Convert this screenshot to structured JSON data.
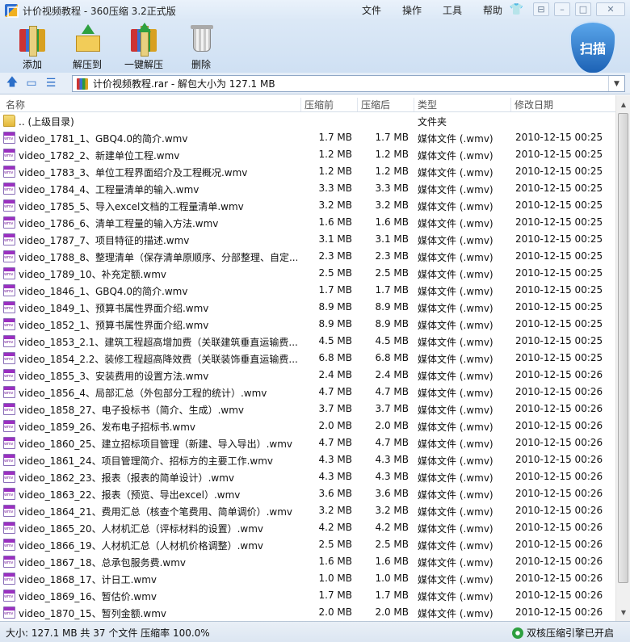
{
  "window": {
    "title": "计价视频教程 - 360压缩 3.2正式版"
  },
  "menu": [
    "文件",
    "操作",
    "工具",
    "帮助"
  ],
  "toolbar": {
    "add": "添加",
    "extract_to": "解压到",
    "one_click": "一键解压",
    "delete": "删除",
    "scan": "扫描"
  },
  "address": {
    "text": "计价视频教程.rar - 解包大小为 127.1 MB"
  },
  "columns": {
    "name": "名称",
    "packed": "压缩前",
    "unpacked": "压缩后",
    "type": "类型",
    "modified": "修改日期"
  },
  "parent_row": {
    "name": ".. (上级目录)",
    "type": "文件夹"
  },
  "files": [
    {
      "name": "video_1781_1、GBQ4.0的简介.wmv",
      "size1": "1.7 MB",
      "size2": "1.7 MB",
      "type": "媒体文件 (.wmv)",
      "date": "2010-12-15 00:25"
    },
    {
      "name": "video_1782_2、新建单位工程.wmv",
      "size1": "1.2 MB",
      "size2": "1.2 MB",
      "type": "媒体文件 (.wmv)",
      "date": "2010-12-15 00:25"
    },
    {
      "name": "video_1783_3、单位工程界面绍介及工程概况.wmv",
      "size1": "1.2 MB",
      "size2": "1.2 MB",
      "type": "媒体文件 (.wmv)",
      "date": "2010-12-15 00:25"
    },
    {
      "name": "video_1784_4、工程量清单的输入.wmv",
      "size1": "3.3 MB",
      "size2": "3.3 MB",
      "type": "媒体文件 (.wmv)",
      "date": "2010-12-15 00:25"
    },
    {
      "name": "video_1785_5、导入excel文档的工程量清单.wmv",
      "size1": "3.2 MB",
      "size2": "3.2 MB",
      "type": "媒体文件 (.wmv)",
      "date": "2010-12-15 00:25"
    },
    {
      "name": "video_1786_6、清单工程量的输入方法.wmv",
      "size1": "1.6 MB",
      "size2": "1.6 MB",
      "type": "媒体文件 (.wmv)",
      "date": "2010-12-15 00:25"
    },
    {
      "name": "video_1787_7、项目特征的描述.wmv",
      "size1": "3.1 MB",
      "size2": "3.1 MB",
      "type": "媒体文件 (.wmv)",
      "date": "2010-12-15 00:25"
    },
    {
      "name": "video_1788_8、整理清单（保存清单原顺序、分部整理、自定...",
      "size1": "2.3 MB",
      "size2": "2.3 MB",
      "type": "媒体文件 (.wmv)",
      "date": "2010-12-15 00:25"
    },
    {
      "name": "video_1789_10、补充定额.wmv",
      "size1": "2.5 MB",
      "size2": "2.5 MB",
      "type": "媒体文件 (.wmv)",
      "date": "2010-12-15 00:25"
    },
    {
      "name": "video_1846_1、GBQ4.0的简介.wmv",
      "size1": "1.7 MB",
      "size2": "1.7 MB",
      "type": "媒体文件 (.wmv)",
      "date": "2010-12-15 00:25"
    },
    {
      "name": "video_1849_1、预算书属性界面介绍.wmv",
      "size1": "8.9 MB",
      "size2": "8.9 MB",
      "type": "媒体文件 (.wmv)",
      "date": "2010-12-15 00:25"
    },
    {
      "name": "video_1852_1、预算书属性界面介绍.wmv",
      "size1": "8.9 MB",
      "size2": "8.9 MB",
      "type": "媒体文件 (.wmv)",
      "date": "2010-12-15 00:25"
    },
    {
      "name": "video_1853_2.1、建筑工程超高增加费（关联建筑垂直运输费...",
      "size1": "4.5 MB",
      "size2": "4.5 MB",
      "type": "媒体文件 (.wmv)",
      "date": "2010-12-15 00:25"
    },
    {
      "name": "video_1854_2.2、装修工程超高降效费（关联装饰垂直运输费...",
      "size1": "6.8 MB",
      "size2": "6.8 MB",
      "type": "媒体文件 (.wmv)",
      "date": "2010-12-15 00:25"
    },
    {
      "name": "video_1855_3、安装费用的设置方法.wmv",
      "size1": "2.4 MB",
      "size2": "2.4 MB",
      "type": "媒体文件 (.wmv)",
      "date": "2010-12-15 00:26"
    },
    {
      "name": "video_1856_4、局部汇总（外包部分工程的统计）.wmv",
      "size1": "4.7 MB",
      "size2": "4.7 MB",
      "type": "媒体文件 (.wmv)",
      "date": "2010-12-15 00:26"
    },
    {
      "name": "video_1858_27、电子投标书（简介、生成）.wmv",
      "size1": "3.7 MB",
      "size2": "3.7 MB",
      "type": "媒体文件 (.wmv)",
      "date": "2010-12-15 00:26"
    },
    {
      "name": "video_1859_26、发布电子招标书.wmv",
      "size1": "2.0 MB",
      "size2": "2.0 MB",
      "type": "媒体文件 (.wmv)",
      "date": "2010-12-15 00:26"
    },
    {
      "name": "video_1860_25、建立招标项目管理（新建、导入导出）.wmv",
      "size1": "4.7 MB",
      "size2": "4.7 MB",
      "type": "媒体文件 (.wmv)",
      "date": "2010-12-15 00:26"
    },
    {
      "name": "video_1861_24、项目管理简介、招标方的主要工作.wmv",
      "size1": "4.3 MB",
      "size2": "4.3 MB",
      "type": "媒体文件 (.wmv)",
      "date": "2010-12-15 00:26"
    },
    {
      "name": "video_1862_23、报表（报表的简单设计）.wmv",
      "size1": "4.3 MB",
      "size2": "4.3 MB",
      "type": "媒体文件 (.wmv)",
      "date": "2010-12-15 00:26"
    },
    {
      "name": "video_1863_22、报表（预览、导出excel）.wmv",
      "size1": "3.6 MB",
      "size2": "3.6 MB",
      "type": "媒体文件 (.wmv)",
      "date": "2010-12-15 00:26"
    },
    {
      "name": "video_1864_21、费用汇总（核查个笔费用、简单调价）.wmv",
      "size1": "3.2 MB",
      "size2": "3.2 MB",
      "type": "媒体文件 (.wmv)",
      "date": "2010-12-15 00:26"
    },
    {
      "name": "video_1865_20、人材机汇总（评标材料的设置）.wmv",
      "size1": "4.2 MB",
      "size2": "4.2 MB",
      "type": "媒体文件 (.wmv)",
      "date": "2010-12-15 00:26"
    },
    {
      "name": "video_1866_19、人材机汇总（人材机价格调整）.wmv",
      "size1": "2.5 MB",
      "size2": "2.5 MB",
      "type": "媒体文件 (.wmv)",
      "date": "2010-12-15 00:26"
    },
    {
      "name": "video_1867_18、总承包服务费.wmv",
      "size1": "1.6 MB",
      "size2": "1.6 MB",
      "type": "媒体文件 (.wmv)",
      "date": "2010-12-15 00:26"
    },
    {
      "name": "video_1868_17、计日工.wmv",
      "size1": "1.0 MB",
      "size2": "1.0 MB",
      "type": "媒体文件 (.wmv)",
      "date": "2010-12-15 00:26"
    },
    {
      "name": "video_1869_16、暂估价.wmv",
      "size1": "1.7 MB",
      "size2": "1.7 MB",
      "type": "媒体文件 (.wmv)",
      "date": "2010-12-15 00:26"
    },
    {
      "name": "video_1870_15、暂列金额.wmv",
      "size1": "2.0 MB",
      "size2": "2.0 MB",
      "type": "媒体文件 (.wmv)",
      "date": "2010-12-15 00:26"
    }
  ],
  "status": {
    "summary": "大小: 127.1 MB 共 37 个文件 压缩率 100.0%",
    "engine": "双核压缩引擎已开启"
  }
}
